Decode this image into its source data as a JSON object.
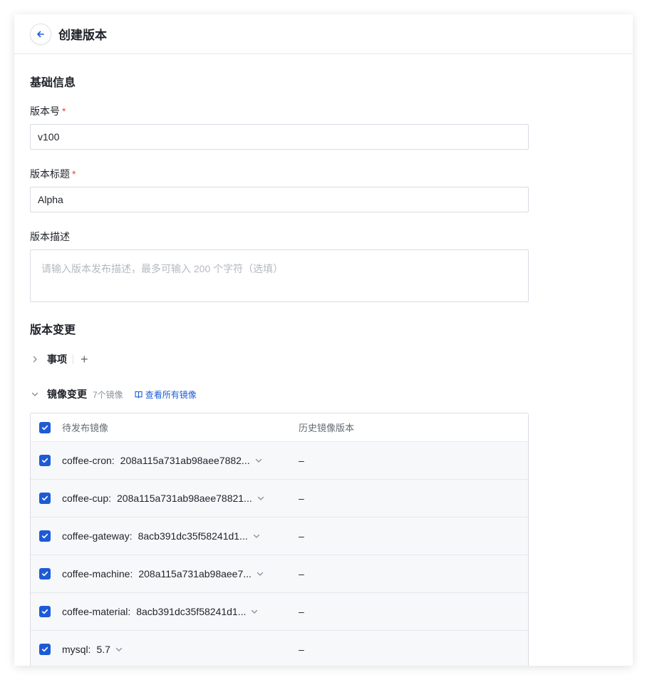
{
  "header": {
    "title": "创建版本"
  },
  "basic": {
    "section_title": "基础信息",
    "version_label": "版本号",
    "version_value": "v100",
    "title_label": "版本标题",
    "title_value": "Alpha",
    "required_mark": "*",
    "desc_label": "版本描述",
    "desc_placeholder": "请输入版本发布描述，最多可输入 200 个字符（选填）"
  },
  "changes": {
    "section_title": "版本变更",
    "items_label": "事项",
    "add_symbol": "+",
    "images_label": "镜像变更",
    "images_count": "7个镜像",
    "view_all_link": "查看所有镜像"
  },
  "table": {
    "col_pending": "待发布镜像",
    "col_history": "历史镜像版本",
    "rows": [
      {
        "name": "coffee-cron:",
        "version": "208a115a731ab98aee7882...",
        "history": "–"
      },
      {
        "name": "coffee-cup:",
        "version": "208a115a731ab98aee78821...",
        "history": "–"
      },
      {
        "name": "coffee-gateway:",
        "version": "8acb391dc35f58241d1...",
        "history": "–"
      },
      {
        "name": "coffee-machine:",
        "version": "208a115a731ab98aee7...",
        "history": "–"
      },
      {
        "name": "coffee-material:",
        "version": "8acb391dc35f58241d1...",
        "history": "–"
      },
      {
        "name": "mysql:",
        "version": "5.7",
        "history": "–"
      }
    ]
  },
  "colors": {
    "accent": "#1d5bd6",
    "required": "#f04141",
    "border": "#d8dce3"
  },
  "icons": {
    "back": "arrow-left-icon",
    "collapse": "chevron-right-icon",
    "expand": "chevron-down-icon",
    "link": "book-icon",
    "check": "checkmark-icon"
  }
}
